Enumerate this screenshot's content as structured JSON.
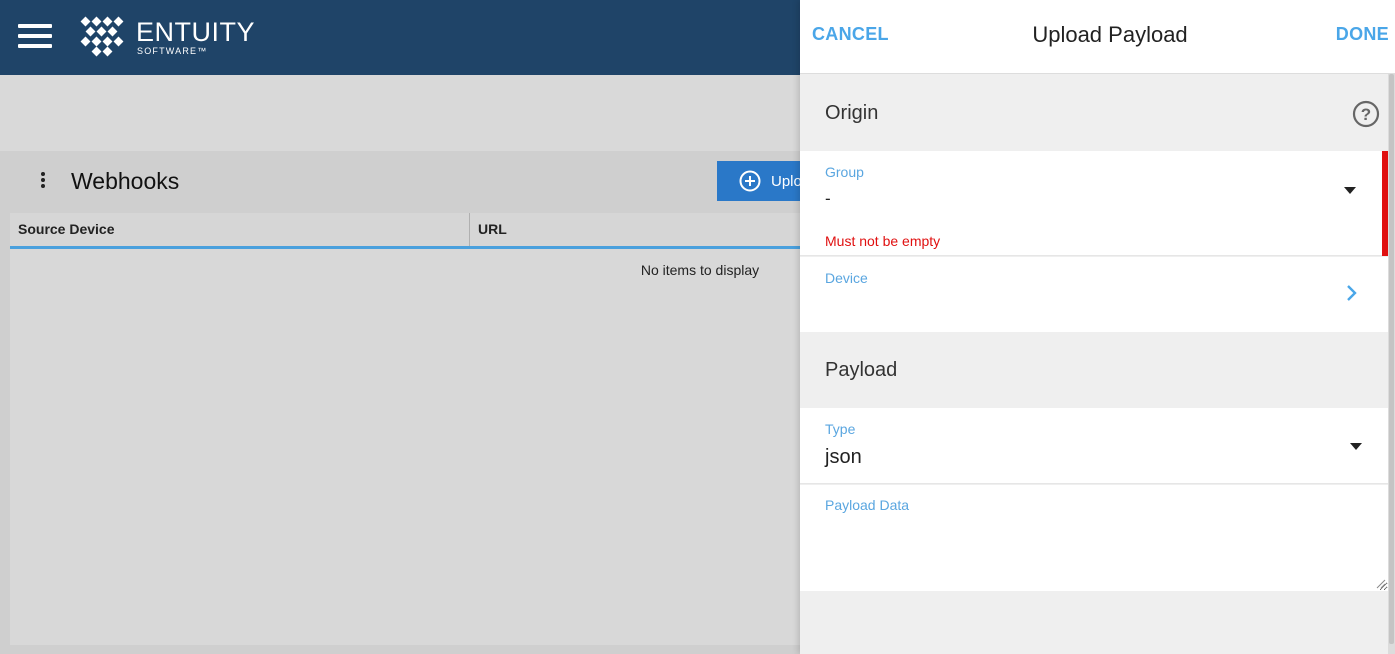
{
  "header": {
    "brand": "ENTUITY",
    "brand_sub": "SOFTWARE™"
  },
  "webhooks": {
    "title": "Webhooks",
    "upload_button": "Upload",
    "columns": [
      "Source Device",
      "URL"
    ],
    "empty_text": "No items to display"
  },
  "drawer": {
    "cancel": "CANCEL",
    "title": "Upload Payload",
    "done": "DONE",
    "origin": {
      "heading": "Origin",
      "group_label": "Group",
      "group_value": "-",
      "group_error": "Must not be empty",
      "device_label": "Device",
      "device_value": ""
    },
    "payload": {
      "heading": "Payload",
      "type_label": "Type",
      "type_value": "json",
      "data_label": "Payload Data",
      "data_value": ""
    }
  },
  "colors": {
    "header_bg": "#1f4468",
    "accent": "#4aa6e8",
    "button": "#2a78c8",
    "error": "#e01010"
  }
}
